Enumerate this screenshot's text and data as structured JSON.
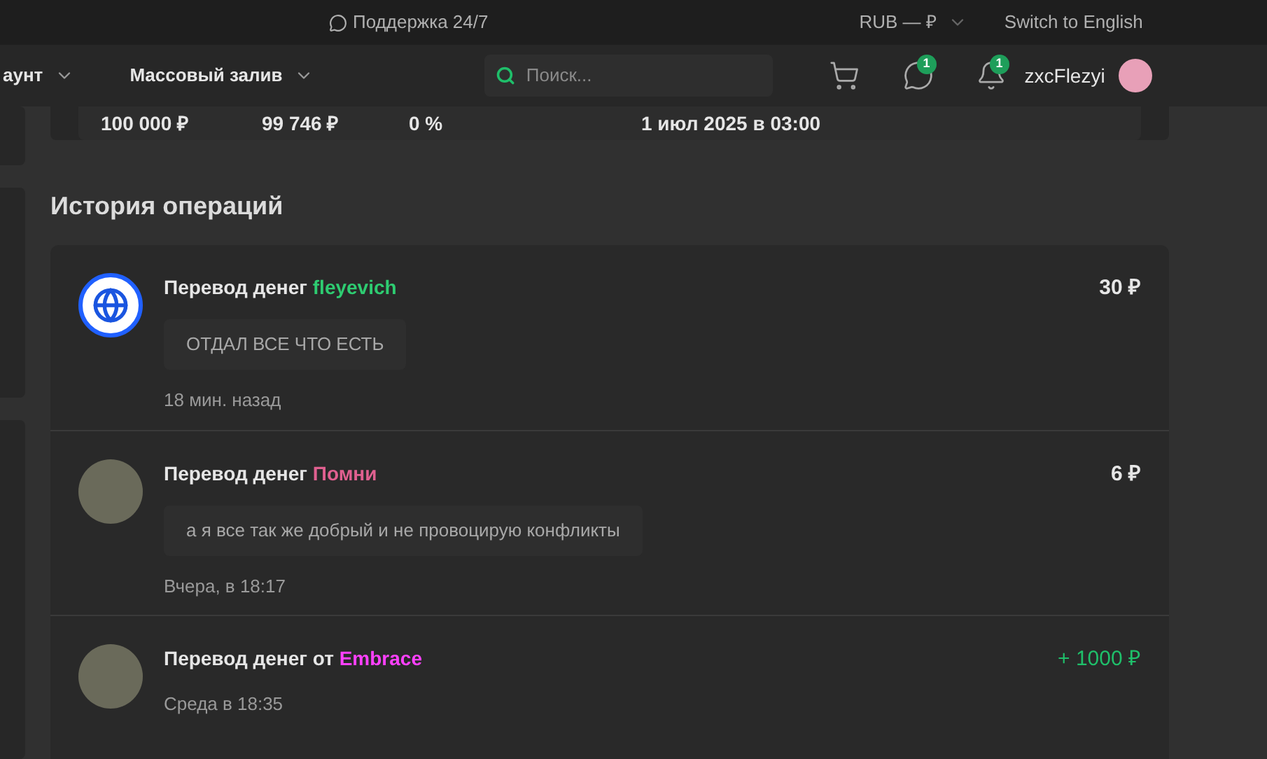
{
  "top_bar": {
    "support": "Поддержка 24/7",
    "currency": "RUB — ₽",
    "language": "Switch to English"
  },
  "nav": {
    "items": [
      {
        "label": "аунт"
      },
      {
        "label": "Массовый залив"
      }
    ],
    "search": {
      "placeholder": "Поиск..."
    },
    "messages_badge": "1",
    "notifications_badge": "1",
    "username": "zxcFlezyi"
  },
  "stats_row": [
    "100 000 ₽",
    "99 746 ₽",
    "0 %",
    "1 июл 2025 в 03:00"
  ],
  "history": {
    "title": "История операций",
    "operations": [
      {
        "title": "Перевод денег",
        "user": "fleyevich",
        "color": "#2ecc71",
        "comment": "ОТДАЛ ВСЕ ЧТО ЕСТЬ",
        "time": "18 мин. назад",
        "amount": "30 ₽",
        "incoming": false,
        "kind": "globe"
      },
      {
        "title": "Перевод денег",
        "user": "Помни",
        "color": "#e06090",
        "comment": "а я все так же добрый и не провоцирую конфликты",
        "time": "Вчера, в 18:17",
        "amount": "6 ₽",
        "incoming": false,
        "kind": "photo"
      },
      {
        "title": "Перевод денег",
        "preposition": "от",
        "user": "Embrace",
        "color": "#ff40ff",
        "time": "Среда в 18:35",
        "amount": "+ 1000 ₽",
        "incoming": true,
        "kind": "photo"
      }
    ]
  }
}
